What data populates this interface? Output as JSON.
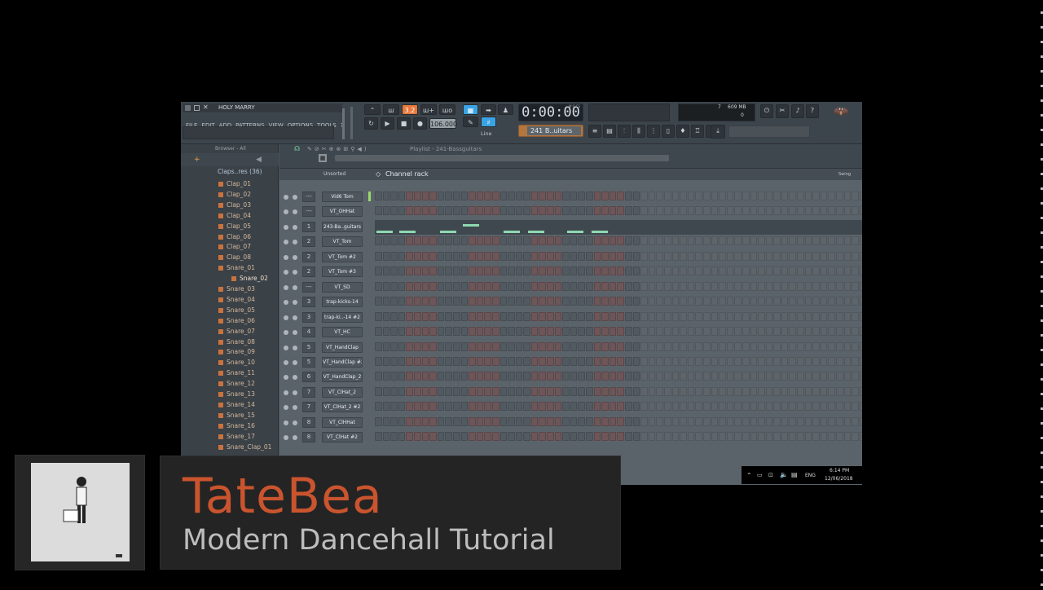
{
  "window": {
    "project_name": "HOLY MARRY",
    "menu": [
      "FILE",
      "EDIT",
      "ADD",
      "PATTERNS",
      "VIEW",
      "OPTIONS",
      "TOOLS",
      "?"
    ],
    "tempo": "106.000",
    "time": "0:00:00",
    "time_unit": "M:S:CS",
    "pattern_select": "241 B..uitars",
    "snap_mode": "Line",
    "cpu_label": "7",
    "memory": "609 MB",
    "memory_sub": "0",
    "pattern_number": "3.2"
  },
  "browser": {
    "header": "Browser - All",
    "folder": "Claps..res (36)",
    "items": [
      "Clap_01",
      "Clap_02",
      "Clap_03",
      "Clap_04",
      "Clap_05",
      "Clap_06",
      "Clap_07",
      "Clap_08",
      "Snare_01",
      "Snare_02",
      "Snare_03",
      "Snare_04",
      "Snare_05",
      "Snare_06",
      "Snare_07",
      "Snare_08",
      "Snare_09",
      "Snare_10",
      "Snare_11",
      "Snare_12",
      "Snare_13",
      "Snare_14",
      "Snare_15",
      "Snare_16",
      "Snare_17",
      "Snare_Clap_01"
    ],
    "selected": "Snare_02"
  },
  "playlist": {
    "title": "Playlist - 241-Bassguitars"
  },
  "channel_rack": {
    "title": "Channel rack",
    "filter": "Unsorted",
    "swing_label": "Swing",
    "channels": [
      {
        "num": "---",
        "name": "Vid6 Tom"
      },
      {
        "num": "---",
        "name": "VT_OHHat"
      },
      {
        "num": "1",
        "name": "243-Ba..guitars"
      },
      {
        "num": "2",
        "name": "VT_Tom"
      },
      {
        "num": "2",
        "name": "VT_Tom #2"
      },
      {
        "num": "2",
        "name": "VT_Tom #3"
      },
      {
        "num": "---",
        "name": "VT_SD"
      },
      {
        "num": "3",
        "name": "trap-kicks-14"
      },
      {
        "num": "3",
        "name": "trap-ki..-14 #2"
      },
      {
        "num": "4",
        "name": "VT_HC"
      },
      {
        "num": "5",
        "name": "VT_HandClap"
      },
      {
        "num": "5",
        "name": "VT_HandClap #2"
      },
      {
        "num": "6",
        "name": "VT_HandClap_2"
      },
      {
        "num": "7",
        "name": "VT_ClHat_2"
      },
      {
        "num": "7",
        "name": "VT_ClHat_2 #2"
      },
      {
        "num": "8",
        "name": "VT_ClHHat"
      },
      {
        "num": "8",
        "name": "VT_ClHat #2"
      }
    ]
  },
  "taskbar": {
    "language": "ENG",
    "time": "6:14 PM",
    "date": "12/06/2018"
  },
  "overlay": {
    "title": "TateBea",
    "subtitle": "Modern Dancehall Tutorial"
  },
  "colors": {
    "title_orange": "#c9542e",
    "subtitle_gray": "#bdbdbd",
    "note_green": "#8ed8b0",
    "accent_orange": "#e8783c"
  }
}
